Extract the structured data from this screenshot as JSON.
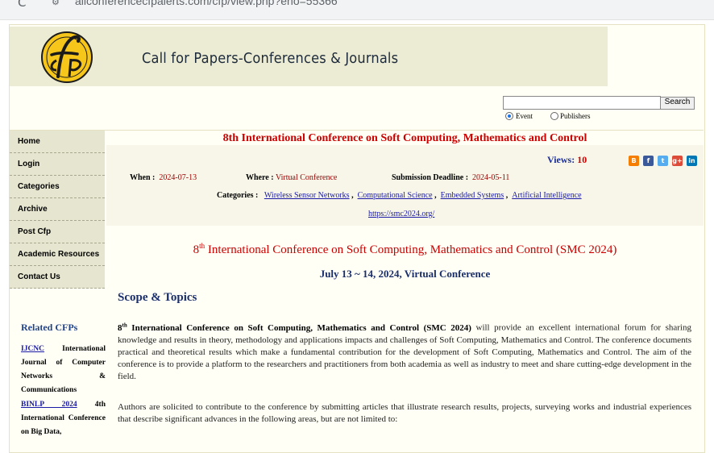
{
  "browser": {
    "url": "allconferencecfpalerts.com/cfp/view.php?eno=55366",
    "reload_glyph": "C",
    "site_glyph": "⚙"
  },
  "header": {
    "title": "Call for Papers-Conferences & Journals"
  },
  "search": {
    "button": "Search",
    "options": [
      "Event",
      "Publishers"
    ],
    "selected": "Event"
  },
  "nav": {
    "items": [
      "Home",
      "Login",
      "Categories",
      "Archive",
      "Post Cfp",
      "Academic Resources",
      "Contact Us"
    ]
  },
  "related": {
    "title": "Related CFPs",
    "items": [
      {
        "link": "IJCNC",
        "text": "International Journal of Computer Networks & Communications"
      },
      {
        "link": "BINLP 2024",
        "text": "4th International Conference on Big Data,"
      }
    ]
  },
  "event": {
    "title": "8th International Conference on Soft Computing, Mathematics and Control",
    "views_label": "Views:",
    "views": "10",
    "when_label": "When :",
    "when": "2024-07-13",
    "where_label": "Where :",
    "where": "Virtual Conference",
    "deadline_label": "Submission Deadline :",
    "deadline": "2024-05-11",
    "categories_label": "Categories :",
    "categories": [
      "Wireless Sensor Networks",
      "Computational Science",
      "Embedded Systems",
      "Artificial Intelligence"
    ],
    "link": "https://smc2024.org/",
    "full_title_num": "8",
    "full_title_sup": "th",
    "full_title_rest": " International Conference on Soft Computing, Mathematics and Control (SMC 2024)",
    "dates": "July 13 ~ 14, 2024, Virtual Conference",
    "scope_heading": "Scope & Topics",
    "para1_num": "8",
    "para1_sup": "th",
    "para1_bold": " International Conference on Soft Computing, Mathematics and Control (SMC 2024)",
    "para1_rest": " will provide an excellent international forum for sharing knowledge and results in theory, methodology and applications impacts and challenges of Soft Computing, Mathematics and Control. The conference documents practical and theoretical results which make a fundamental contribution for the development of Soft Computing, Mathematics and Control. The aim of the conference is to provide a platform to the researchers and practitioners from both academia as well as industry to meet and share cutting-edge development in the field.",
    "para2": "Authors are solicited to contribute to the conference by submitting articles that illustrate research results, projects, surveying works and industrial experiences that describe significant advances in the following areas, but are not limited to:"
  },
  "social": {
    "icons": [
      {
        "name": "blogger-icon",
        "glyph": "B",
        "color": "#f57d00"
      },
      {
        "name": "facebook-icon",
        "glyph": "f",
        "color": "#3b5998"
      },
      {
        "name": "twitter-icon",
        "glyph": "t",
        "color": "#55acee"
      },
      {
        "name": "googleplus-icon",
        "glyph": "g+",
        "color": "#dd4b39"
      },
      {
        "name": "linkedin-icon",
        "glyph": "in",
        "color": "#0077b5"
      }
    ]
  },
  "colors": {
    "accent_red": "#cc0000",
    "accent_blue": "#1a2e6c",
    "nav_bg": "#e6e5cf"
  }
}
